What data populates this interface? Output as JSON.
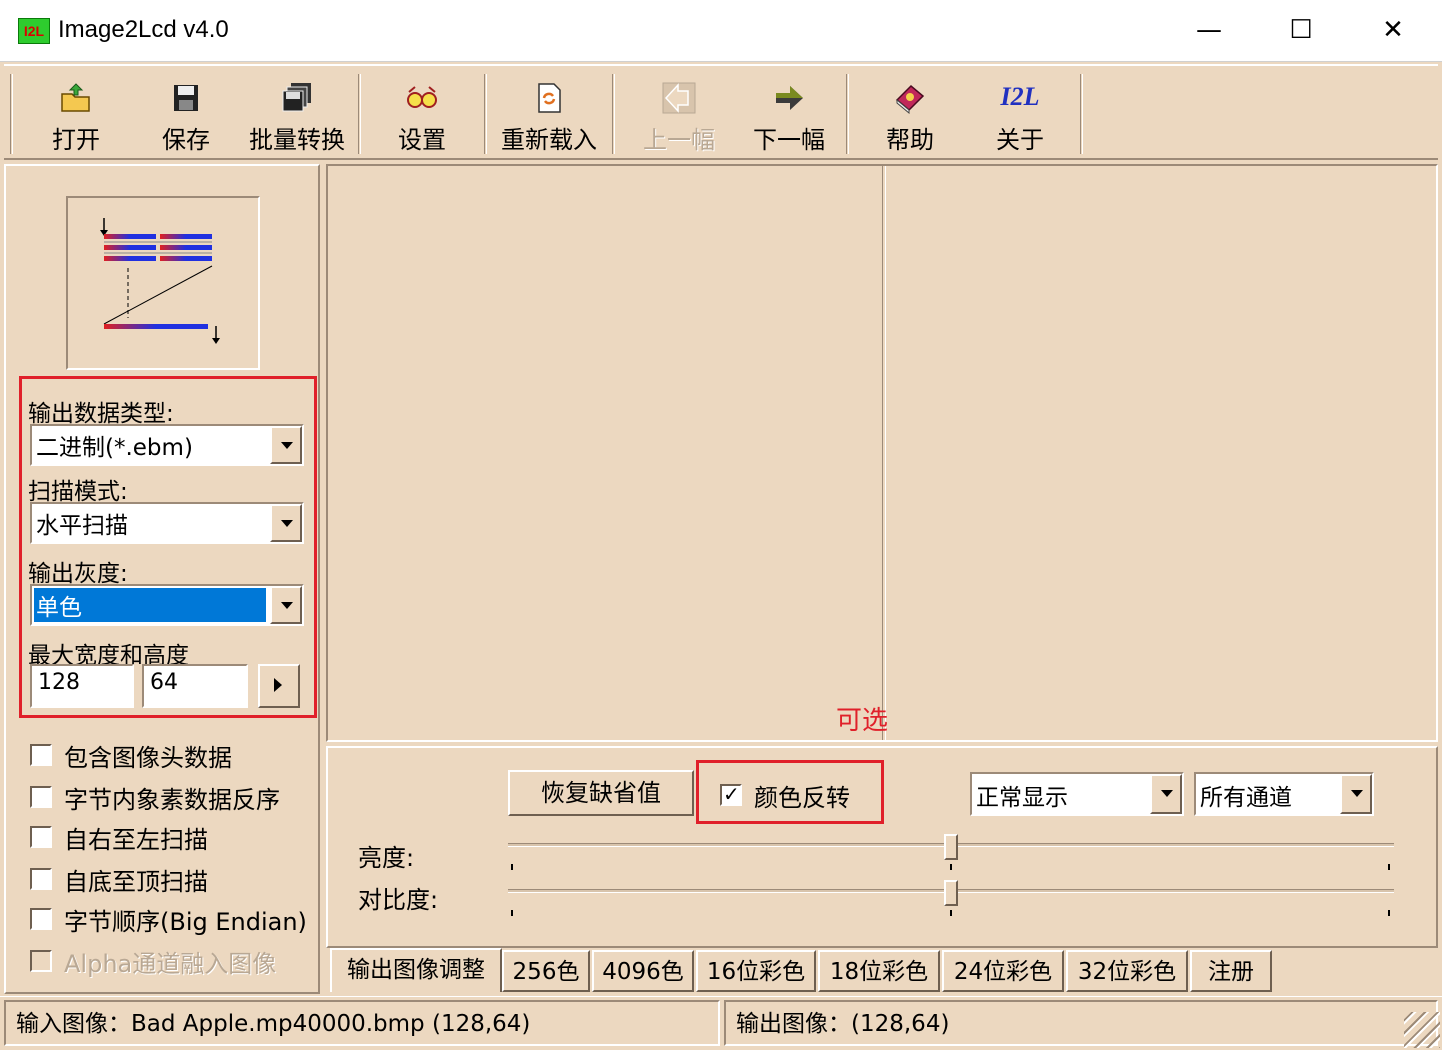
{
  "window": {
    "title": "Image2Lcd v4.0",
    "icon_text": "I2L",
    "minimize": "—",
    "maximize": "☐",
    "close": "✕"
  },
  "toolbar": {
    "open": "打开",
    "save": "保存",
    "batch": "批量转换",
    "settings": "设置",
    "reload": "重新载入",
    "prev": "上一幅",
    "next": "下一幅",
    "help": "帮助",
    "about": "关于",
    "about_logo": "I2L"
  },
  "left": {
    "output_type_label": "输出数据类型:",
    "output_type_value": "二进制(*.ebm)",
    "scan_mode_label": "扫描模式:",
    "scan_mode_value": "水平扫描",
    "gray_label": "输出灰度:",
    "gray_value": "单色",
    "max_size_label": "最大宽度和高度",
    "max_width": "128",
    "max_height": "64",
    "checkboxes": [
      {
        "label": "包含图像头数据",
        "checked": false
      },
      {
        "label": "字节内象素数据反序",
        "checked": false
      },
      {
        "label": "自右至左扫描",
        "checked": false
      },
      {
        "label": "自底至顶扫描",
        "checked": false
      },
      {
        "label": "字节顺序(Big Endian)",
        "checked": false
      },
      {
        "label": "Alpha通道融入图像",
        "checked": false,
        "disabled": true
      }
    ]
  },
  "adjust": {
    "annotation": "可选",
    "restore_default": "恢复缺省值",
    "invert_color_label": "颜色反转",
    "invert_color_checked": true,
    "display_mode": "正常显示",
    "channel": "所有通道",
    "brightness_label": "亮度:",
    "contrast_label": "对比度:",
    "brightness_level": 0.5,
    "contrast_level": 0.5
  },
  "tabs": [
    "输出图像调整",
    "256色",
    "4096色",
    "16位彩色",
    "18位彩色",
    "24位彩色",
    "32位彩色",
    "注册"
  ],
  "active_tab": "输出图像调整",
  "status": {
    "input": "输入图像：Bad Apple.mp40000.bmp (128,64)",
    "output": "输出图像：(128,64)"
  },
  "colors": {
    "background": "#ecd8c0",
    "highlight_box": "#e0202a",
    "selection": "#0078d7"
  }
}
